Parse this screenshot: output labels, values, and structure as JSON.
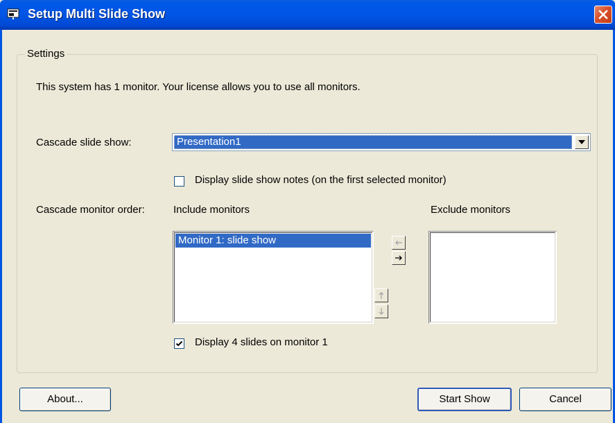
{
  "window": {
    "title": "Setup Multi Slide Show"
  },
  "settings": {
    "group_label": "Settings",
    "info_text": "This system has 1 monitor. Your license allows you to use all monitors.",
    "cascade_show_label": "Cascade slide show:",
    "cascade_show_value": "Presentation1",
    "notes_checkbox": {
      "label": "Display slide show notes (on the first selected monitor)",
      "checked": false
    },
    "monitor_order_label": "Cascade monitor order:",
    "include_label": "Include monitors",
    "exclude_label": "Exclude monitors",
    "include_list": [
      "Monitor 1: slide show"
    ],
    "exclude_list": [],
    "slides_checkbox": {
      "label": "Display 4 slides on monitor 1",
      "checked": true
    }
  },
  "buttons": {
    "about": "About...",
    "start_show": "Start Show",
    "cancel": "Cancel"
  },
  "icons": {
    "app": "slideshow-icon",
    "close": "close-icon",
    "dropdown": "chevron-down-icon",
    "move_left": "arrow-left-icon",
    "move_right": "arrow-right-icon",
    "move_up": "arrow-up-icon",
    "move_down": "arrow-down-icon",
    "check": "checkmark-icon"
  },
  "colors": {
    "titlebar": "#0055e5",
    "selection": "#316ac5",
    "dialog_bg": "#ece9d8",
    "close_button": "#d8512b"
  }
}
